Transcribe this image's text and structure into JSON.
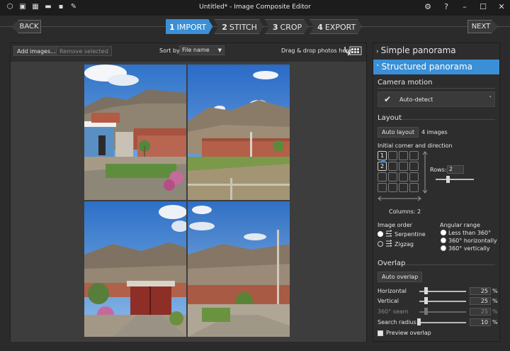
{
  "titlebar": {
    "title": "Untitled* - Image Composite Editor"
  },
  "nav": {
    "back_label": "BACK",
    "next_label": "NEXT",
    "steps": [
      {
        "num": "1",
        "label": "IMPORT",
        "active": true
      },
      {
        "num": "2",
        "label": "STITCH",
        "active": false
      },
      {
        "num": "3",
        "label": "CROP",
        "active": false
      },
      {
        "num": "4",
        "label": "EXPORT",
        "active": false
      }
    ]
  },
  "toolbar": {
    "add_images": "Add images...",
    "remove_selected": "Remove selected",
    "sort_label": "Sort by",
    "sort_value": "File name",
    "drag_drop": "Drag & drop photos here"
  },
  "panel": {
    "simple_panorama": "Simple panorama",
    "structured_panorama": "Structured panorama",
    "camera_motion": {
      "title": "Camera motion",
      "value": "Auto-detect"
    },
    "layout": {
      "title": "Layout",
      "auto_layout": "Auto layout",
      "image_count": "4 images",
      "corner_label": "Initial corner and direction",
      "cell_1": "1",
      "cell_2": "2",
      "rows_label": "Rows:",
      "rows_value": "2",
      "columns_label": "Columns: 2"
    },
    "image_order": {
      "title": "Image order",
      "options": [
        "Serpentine",
        "Zigzag"
      ],
      "selected": "Serpentine"
    },
    "angular_range": {
      "title": "Angular range",
      "options": [
        "Less than 360°",
        "360° horizontally",
        "360° vertically"
      ],
      "selected": "Less than 360°"
    },
    "overlap": {
      "title": "Overlap",
      "auto_overlap": "Auto overlap",
      "horizontal_label": "Horizontal",
      "horizontal_value": "25",
      "vertical_label": "Vertical",
      "vertical_value": "25",
      "seam_label": "360° seam",
      "seam_value": "25",
      "search_label": "Search radius",
      "search_value": "10",
      "pct": "%",
      "preview_label": "Preview overlap"
    }
  },
  "colors": {
    "accent": "#3a8fd6",
    "background": "#2b2b2b"
  }
}
